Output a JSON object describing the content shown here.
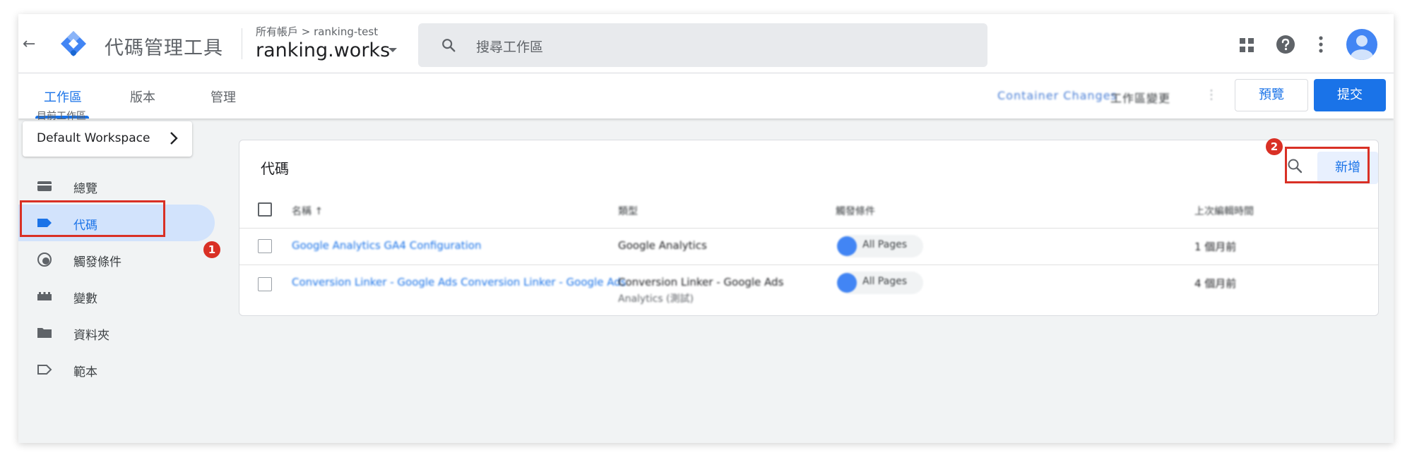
{
  "topbar": {
    "back_icon": "arrow-back-icon",
    "product_name": "代碼管理工具",
    "breadcrumb": "所有帳戶 > ranking-test",
    "container_name": "ranking.works",
    "search_placeholder": "搜尋工作區"
  },
  "tabs": [
    {
      "label": "工作區"
    },
    {
      "label": "版本"
    },
    {
      "label": "管理"
    }
  ],
  "tabbar": {
    "status_changes": "Container Changes",
    "status_workspace": "工作區變更",
    "preview_label": "預覽",
    "submit_label": "提交"
  },
  "sidebar": {
    "workspace_label": "目前工作區",
    "workspace_name": "Default Workspace",
    "items": [
      {
        "label": "總覽",
        "icon": "overview-icon"
      },
      {
        "label": "代碼",
        "icon": "tag-icon"
      },
      {
        "label": "觸發條件",
        "icon": "trigger-icon"
      },
      {
        "label": "變數",
        "icon": "variable-icon"
      },
      {
        "label": "資料夾",
        "icon": "folder-icon"
      },
      {
        "label": "範本",
        "icon": "template-icon"
      }
    ]
  },
  "annotations": {
    "badge_1": "1",
    "badge_2": "2"
  },
  "tags_card": {
    "title": "代碼",
    "new_button": "新增",
    "columns": [
      "名稱 ↑",
      "類型",
      "觸發條件",
      "上次編輯時間"
    ],
    "rows": [
      {
        "name": "Google Analytics GA4 Configuration",
        "type": "Google Analytics",
        "trigger": "All Pages",
        "edited": "1 個月前"
      },
      {
        "name": "Conversion Linker - Google Ads Conversion Linker - Google Ads",
        "type": "Conversion Linker - Google Ads",
        "type_sub": "Analytics (測試)",
        "trigger": "All Pages",
        "edited": "4 個月前"
      }
    ]
  },
  "colors": {
    "accent": "#1a73e8",
    "annotation": "#d93025",
    "active_nav_bg": "#d2e3fc"
  }
}
